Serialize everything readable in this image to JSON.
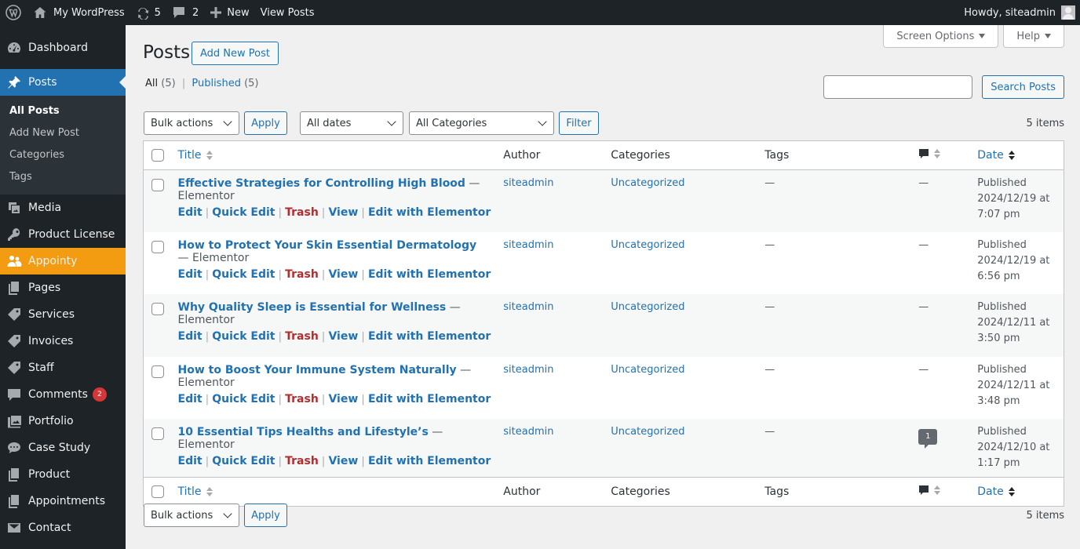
{
  "adminbar": {
    "site_name": "My WordPress",
    "updates_count": "5",
    "comments_count": "2",
    "new_label": "New",
    "view_posts_label": "View Posts",
    "howdy": "Howdy, siteadmin"
  },
  "sidebar": {
    "dashboard": "Dashboard",
    "posts": "Posts",
    "sub": {
      "all_posts": "All Posts",
      "add_new": "Add New Post",
      "categories": "Categories",
      "tags": "Tags"
    },
    "media": "Media",
    "product_license": "Product License",
    "appointy": "Appointy",
    "pages": "Pages",
    "services": "Services",
    "invoices": "Invoices",
    "staff": "Staff",
    "comments": "Comments",
    "comments_badge": "2",
    "portfolio": "Portfolio",
    "case_study": "Case Study",
    "product": "Product",
    "appointments": "Appointments",
    "contact": "Contact"
  },
  "header": {
    "title": "Posts",
    "add_new": "Add New Post",
    "screen_options": "Screen Options",
    "help": "Help"
  },
  "filters": {
    "all_label": "All",
    "all_count": "(5)",
    "published_label": "Published",
    "published_count": "(5)",
    "search_button": "Search Posts",
    "bulk_actions": "Bulk actions",
    "apply": "Apply",
    "all_dates": "All dates",
    "all_categories": "All Categories",
    "filter": "Filter",
    "items_count": "5 items"
  },
  "columns": {
    "title": "Title",
    "author": "Author",
    "categories": "Categories",
    "tags": "Tags",
    "date": "Date"
  },
  "row_actions": {
    "edit": "Edit",
    "quick_edit": "Quick Edit",
    "trash": "Trash",
    "view": "View",
    "edit_elementor": "Edit with Elementor"
  },
  "posts": [
    {
      "title": "Effective Strategies for Controlling High Blood",
      "state": "Elementor",
      "author": "siteadmin",
      "category": "Uncategorized",
      "tags": "—",
      "comments": "—",
      "status": "Published",
      "date": "2024/12/19 at 7:07 pm"
    },
    {
      "title": "How to Protect Your Skin Essential Dermatology",
      "state": "Elementor",
      "author": "siteadmin",
      "category": "Uncategorized",
      "tags": "—",
      "comments": "—",
      "status": "Published",
      "date": "2024/12/19 at 6:56 pm"
    },
    {
      "title": "Why Quality Sleep is Essential for Wellness",
      "state": "Elementor",
      "author": "siteadmin",
      "category": "Uncategorized",
      "tags": "—",
      "comments": "—",
      "status": "Published",
      "date": "2024/12/11 at 3:50 pm"
    },
    {
      "title": "How to Boost Your Immune System Naturally",
      "state": "Elementor",
      "author": "siteadmin",
      "category": "Uncategorized",
      "tags": "—",
      "comments": "—",
      "status": "Published",
      "date": "2024/12/11 at 3:48 pm"
    },
    {
      "title": "10 Essential Tips Healths and Lifestyle’s",
      "state": "Elementor",
      "author": "siteadmin",
      "category": "Uncategorized",
      "tags": "—",
      "comments": "1",
      "status": "Published",
      "date": "2024/12/10 at 1:17 pm"
    }
  ]
}
